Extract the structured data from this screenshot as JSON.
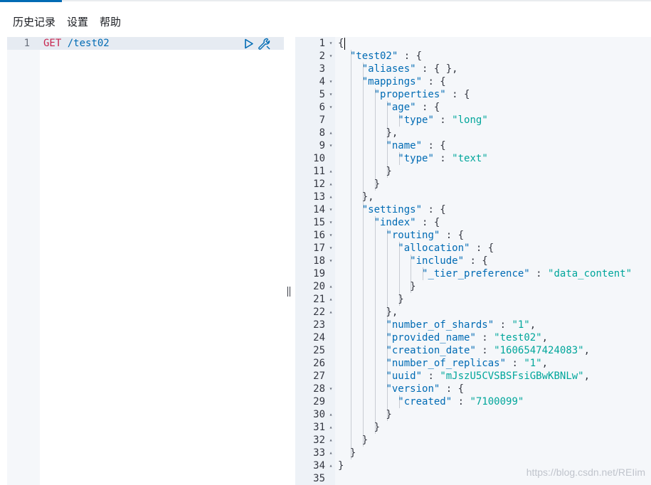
{
  "menu": {
    "items": [
      "历史记录",
      "设置",
      "帮助"
    ]
  },
  "request_editor": {
    "line_number": "1",
    "method": "GET",
    "path": "/test02",
    "run_icon": "play-icon",
    "settings_icon": "wrench-icon"
  },
  "response": {
    "lines": [
      "{",
      "  \"test02\" : {",
      "    \"aliases\" : { },",
      "    \"mappings\" : {",
      "      \"properties\" : {",
      "        \"age\" : {",
      "          \"type\" : \"long\"",
      "        },",
      "        \"name\" : {",
      "          \"type\" : \"text\"",
      "        }",
      "      }",
      "    },",
      "    \"settings\" : {",
      "      \"index\" : {",
      "        \"routing\" : {",
      "          \"allocation\" : {",
      "            \"include\" : {",
      "              \"_tier_preference\" : \"data_content\"",
      "            }",
      "          }",
      "        },",
      "        \"number_of_shards\" : \"1\",",
      "        \"provided_name\" : \"test02\",",
      "        \"creation_date\" : \"1606547424083\",",
      "        \"number_of_replicas\" : \"1\",",
      "        \"uuid\" : \"mJszU5CVSBSFsiGBwKBNLw\",",
      "        \"version\" : {",
      "          \"created\" : \"7100099\"",
      "        }",
      "      }",
      "    }",
      "  }",
      "}",
      ""
    ],
    "folds": [
      "down",
      "down",
      "",
      "down",
      "down",
      "down",
      "",
      "up",
      "down",
      "",
      "up",
      "up",
      "up",
      "down",
      "down",
      "down",
      "down",
      "down",
      "",
      "up",
      "up",
      "up",
      "",
      "",
      "",
      "",
      "",
      "down",
      "",
      "up",
      "up",
      "up",
      "up",
      "up",
      ""
    ]
  },
  "colors": {
    "key": "#006bb4",
    "string": "#00a69b",
    "method": "#c7254e",
    "punctuation": "#343741"
  },
  "watermark": "https://blog.csdn.net/REIim"
}
